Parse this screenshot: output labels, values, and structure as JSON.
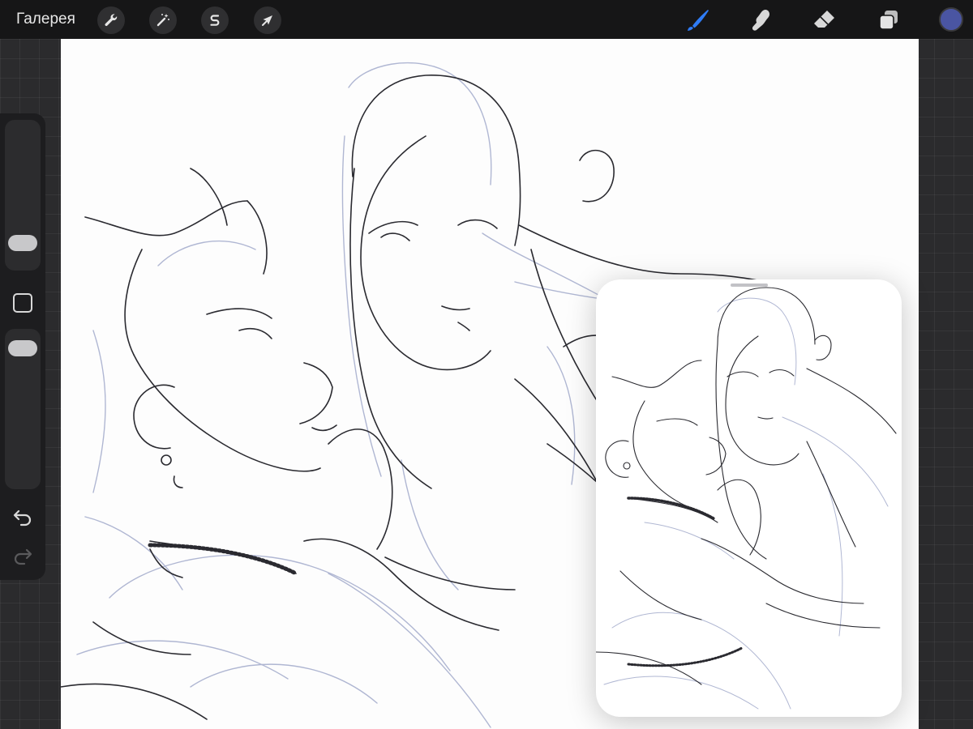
{
  "topbar": {
    "gallery_label": "Галерея",
    "left_tools": [
      {
        "name": "actions",
        "icon": "wrench-icon"
      },
      {
        "name": "adjustments",
        "icon": "magic-wand-icon"
      },
      {
        "name": "selection",
        "icon": "selection-s-icon"
      },
      {
        "name": "transform",
        "icon": "arrow-cursor-icon"
      }
    ],
    "right_tools": [
      {
        "name": "brush",
        "icon": "brush-icon",
        "active": true
      },
      {
        "name": "smudge",
        "icon": "smudge-icon",
        "active": false
      },
      {
        "name": "eraser",
        "icon": "eraser-icon",
        "active": false
      },
      {
        "name": "layers",
        "icon": "layers-icon",
        "active": false
      }
    ],
    "current_color": "#4a55a2"
  },
  "sidebar": {
    "brush_size_icon": "slider-thumb",
    "modify_button_icon": "square-icon",
    "opacity_icon": "slider-thumb",
    "undo_icon": "undo-arrow-icon",
    "redo_icon": "redo-arrow-icon",
    "redo_enabled": false
  },
  "canvas": {
    "content": "sketch-drawing",
    "line_color": "#2a2a30",
    "guide_color": "#8f99c0"
  },
  "reference_window": {
    "content": "reference-image-thumbnail"
  },
  "colors": {
    "accent": "#2f7cf6",
    "background": "#2b2b2d",
    "toolbar": "#161617"
  }
}
